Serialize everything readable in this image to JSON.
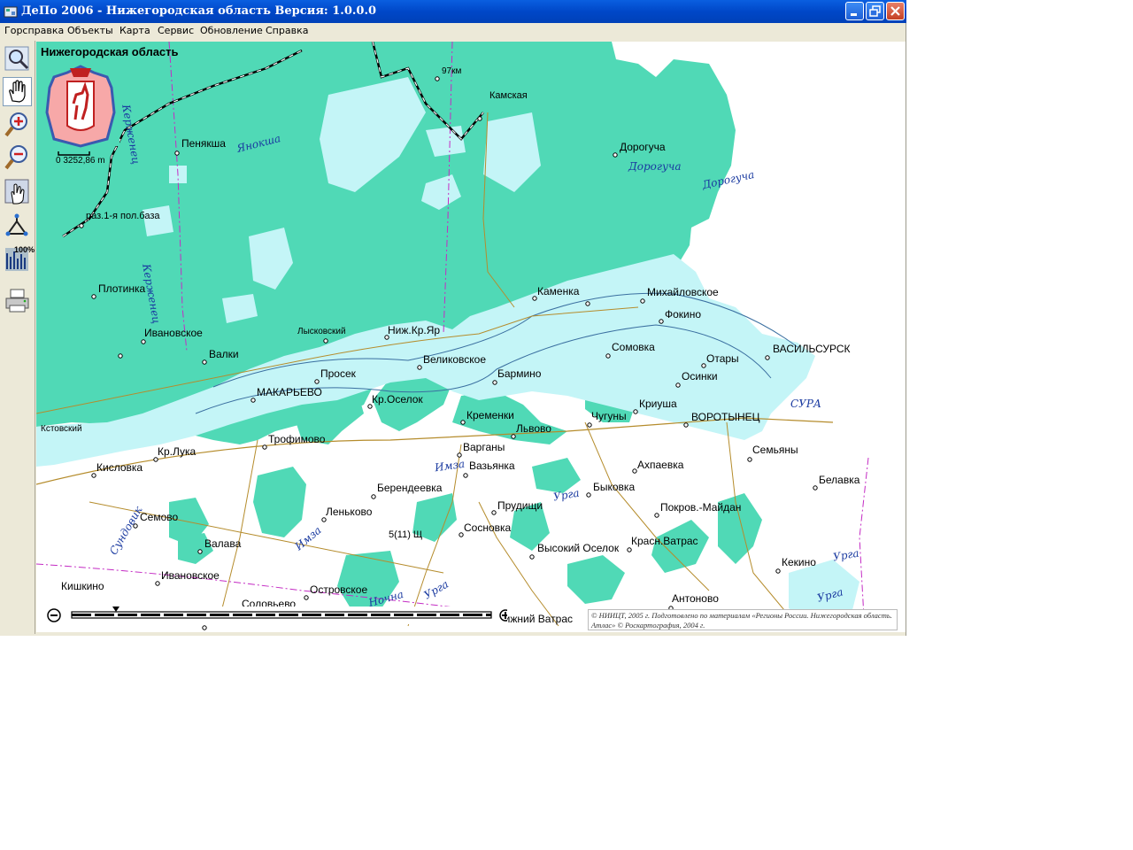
{
  "window": {
    "title": "ДеПо 2006 - Нижегородская область Версия: 1.0.0.0"
  },
  "menu": [
    "Горсправка",
    "Объекты",
    "Карта",
    "Сервис",
    "Обновление",
    "Справка"
  ],
  "toolbar": {
    "tools": [
      "zoom-area-tool",
      "pan-tool",
      "zoom-in-tool",
      "zoom-out-tool",
      "info-pointer-tool",
      "route-tool",
      "zoom-100-tool",
      "print-tool"
    ],
    "active": "pan-tool",
    "zoom100_label": "100%"
  },
  "map": {
    "region_title": "Нижегородская область",
    "scale_label": "0  3252,86 m",
    "settlements": [
      "Пенякша",
      "97км",
      "Камская",
      "Дорогуча",
      "раз.1-я пол.база",
      "Плотинка",
      "Ивановское",
      "Лысковский",
      "Ниж.Кр.Яр",
      "Каменка",
      "Михайловское",
      "Фокино",
      "Валки",
      "Великовское",
      "Сомовка",
      "ВАСИЛЬСУРСК",
      "Отары",
      "Просек",
      "МАКАРЬЕВО",
      "Бармино",
      "Осинки",
      "Кр.Оселок",
      "Кстовский",
      "Кременки",
      "Чугуны",
      "Криуша",
      "ВОРОТЫНЕЦ",
      "Трофимово",
      "Львово",
      "Варганы",
      "Кр.Лука",
      "Кисловка",
      "Вазьянка",
      "Ахпаевка",
      "Семьяны",
      "Берендеевка",
      "Быковка",
      "Белавка",
      "Прудищи",
      "Покров.-Майдан",
      "Семово",
      "Леньково",
      "5(11) Щ",
      "Сосновка",
      "Красн.Ватрас",
      "Валава",
      "Высокий Оселок",
      "Кекино",
      "Ивановское",
      "Кишкино",
      "Островское",
      "Антоново",
      "Соловьево",
      "Нижний Ватрас"
    ],
    "rivers": [
      "Керженец",
      "Янокша",
      "Дорогуча",
      "Дорогуча",
      "Керженец",
      "СУРА",
      "Имза",
      "Урга",
      "Имза",
      "Сундовик",
      "Урга",
      "Ночна",
      "Урга",
      "Ургa"
    ],
    "copyright": "© НИИЦТ, 2005 г. Подготовлено по материалам «Регионы России. Нижегородская область. Атлас» © Роскартография, 2004 г."
  },
  "colors": {
    "forest": "#50d9b6",
    "water": "#c4f5f7",
    "roads": "#b58c2c",
    "boundary": "#c42cc4",
    "titlebar": "#0a5fe0"
  }
}
